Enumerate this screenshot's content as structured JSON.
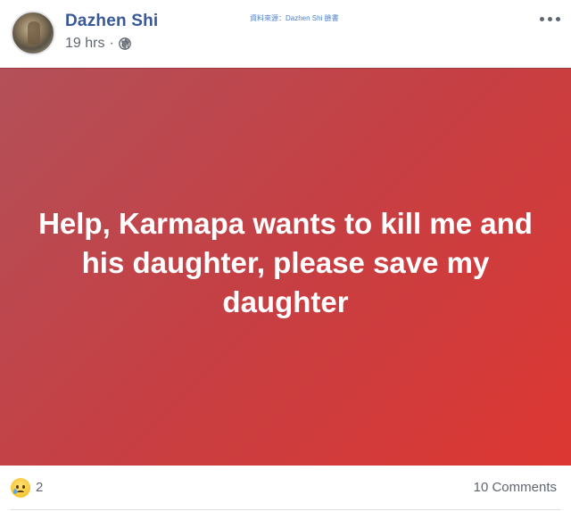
{
  "header": {
    "author_name": "Dazhen Shi",
    "timestamp": "19 hrs",
    "separator": "·",
    "source_note": "資料來源：Dazhen Shi 臉書",
    "privacy_icon": "globe-icon",
    "more_icon": "more-options-icon"
  },
  "post": {
    "text": "Help, Karmapa wants to kill me and his daughter, please save my daughter",
    "background_gradient": [
      "#b35059",
      "#c63f43",
      "#dd3732"
    ],
    "text_color": "#ffffff"
  },
  "footer": {
    "reaction_icon": "sad-reaction-icon",
    "reaction_count": "2",
    "comments": "10 Comments"
  },
  "colors": {
    "author_link": "#385898",
    "meta_text": "#606770",
    "source_note": "#4a7fd0"
  }
}
